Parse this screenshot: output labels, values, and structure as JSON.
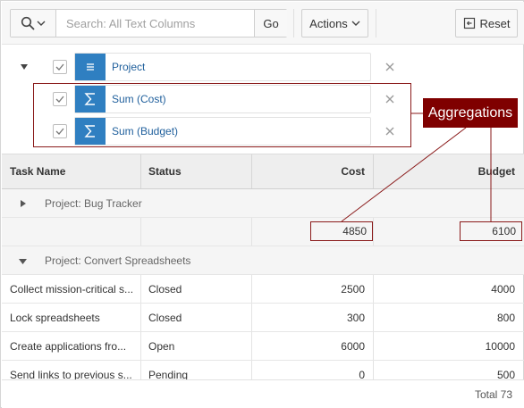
{
  "toolbar": {
    "search_placeholder": "Search: All Text Columns",
    "go_label": "Go",
    "actions_label": "Actions",
    "reset_label": "Reset"
  },
  "controls": [
    {
      "label": "Project",
      "icon": "list-icon"
    },
    {
      "label": "Sum (Cost)",
      "icon": "sigma-icon"
    },
    {
      "label": "Sum (Budget)",
      "icon": "sigma-icon"
    }
  ],
  "callout": {
    "label": "Aggregations"
  },
  "table": {
    "headers": {
      "task": "Task Name",
      "status": "Status",
      "cost": "Cost",
      "budget": "Budget"
    },
    "groups": [
      {
        "label": "Project: Bug Tracker",
        "sum_cost": "4850",
        "sum_budget": "6100"
      },
      {
        "label": "Project: Convert Spreadsheets"
      }
    ],
    "rows": [
      {
        "task": "Collect mission-critical s...",
        "status": "Closed",
        "cost": "2500",
        "budget": "4000"
      },
      {
        "task": "Lock spreadsheets",
        "status": "Closed",
        "cost": "300",
        "budget": "800"
      },
      {
        "task": "Create applications fro...",
        "status": "Open",
        "cost": "6000",
        "budget": "10000"
      },
      {
        "task": "Send links to previous s...",
        "status": "Pending",
        "cost": "0",
        "budget": "500"
      }
    ]
  },
  "footer": {
    "total": "Total 73"
  },
  "colors": {
    "accent": "#2f7fc1",
    "annotation": "#7f0000"
  }
}
